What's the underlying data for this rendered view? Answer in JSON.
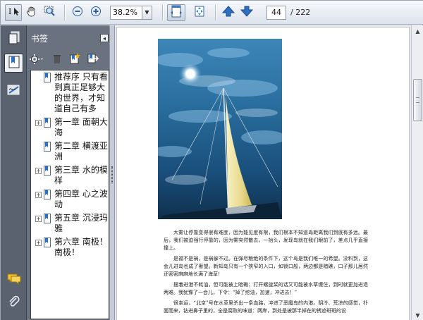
{
  "toolbar": {
    "zoom": "38.2%",
    "page_current": "44",
    "page_total": "/ 222",
    "icons": [
      "select-text-icon",
      "hand-icon",
      "marquee-zoom-icon",
      "zoom-out-icon",
      "zoom-in-icon",
      "fit-width-icon",
      "fit-page-icon",
      "previous-page-icon",
      "next-page-icon"
    ]
  },
  "panel": {
    "title": "书签",
    "close_glyph": "◂"
  },
  "bookmarks": [
    {
      "label": "推荐序 只有看到真正足够大的世界，才知道自己有多",
      "expandable": false
    },
    {
      "label": "第一章 面朝大海",
      "expandable": true
    },
    {
      "label": "第二章 横渡亚洲",
      "expandable": false
    },
    {
      "label": "第三章 水的模样",
      "expandable": true
    },
    {
      "label": "第四章 心之波动",
      "expandable": true
    },
    {
      "label": "第五章 沉浸玛雅",
      "expandable": true
    },
    {
      "label": "第六章 南极！南极！",
      "expandable": true
    }
  ],
  "document": {
    "paragraphs": [
      "大雾让停靠变得很有难度，因为能见度有限，我们根本不知道岛距离我们到底有多远。最后，我们被迫强行停靠的，因为雾突然散去，一抬头，发现岛就在我们眼前了，差点几乎直接撞上。",
      "是福不是祸，是祸躲不过。在弹尽粮绝的条件下，这个岛是我们唯一的希望。没料到，这会儿进岛也成了奢望。新知岛只有一个狭窄的入口，如锁口般，两边都是暗礁，口子那儿居然还密密麻麻地长满了海草！",
      "摆着进港不耗油，但可能被上暗礁；打开螺旋桨的话又可能被水草缠住，到时就更加进退两难。我犹豫了一会儿，下令：“掉了挖油，加速，冲进去！”",
      "很幸运，“北京”号在水草里杀出一条血路，冲进了恶魔岛的内港。阴冷、荒凉的感觉，扑面而来，钻进鼻子里的，全是腐败的味道：两岸，到处是被那半掉在的锈迹斑斑的设"
    ]
  },
  "colors": {
    "rail": "#5a6270",
    "panel": "#6a7280",
    "toolbar_top": "#f6f8fb",
    "accent_blue": "#2d6fc4"
  }
}
